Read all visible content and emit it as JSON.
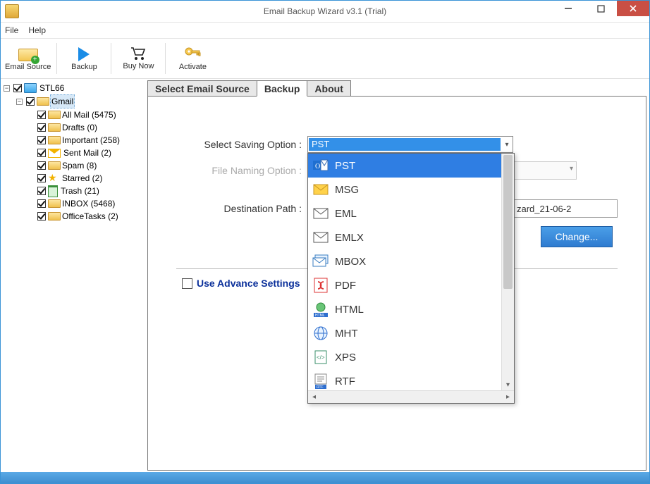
{
  "window": {
    "title": "Email Backup Wizard v3.1 (Trial)"
  },
  "menu": {
    "file": "File",
    "help": "Help"
  },
  "toolbar": {
    "email_source": "Email Source",
    "backup": "Backup",
    "buy_now": "Buy Now",
    "activate": "Activate"
  },
  "tree": {
    "root": "STL66",
    "account": "Gmail",
    "folders": [
      "All Mail (5475)",
      "Drafts (0)",
      "Important (258)",
      "Sent Mail (2)",
      "Spam (8)",
      "Starred (2)",
      "Trash (21)",
      "INBOX (5468)",
      "OfficeTasks (2)"
    ]
  },
  "tabs": {
    "select_source": "Select Email Source",
    "backup": "Backup",
    "about": "About"
  },
  "form": {
    "saving_label": "Select Saving Option  :",
    "saving_value": "PST",
    "naming_label": "File Naming Option  :",
    "dest_label": "Destination Path  :",
    "dest_value": "zard_21-06-2",
    "change_btn": "Change...",
    "advance": "Use Advance Settings"
  },
  "dropdown": {
    "options": [
      "PST",
      "MSG",
      "EML",
      "EMLX",
      "MBOX",
      "PDF",
      "HTML",
      "MHT",
      "XPS",
      "RTF"
    ]
  }
}
